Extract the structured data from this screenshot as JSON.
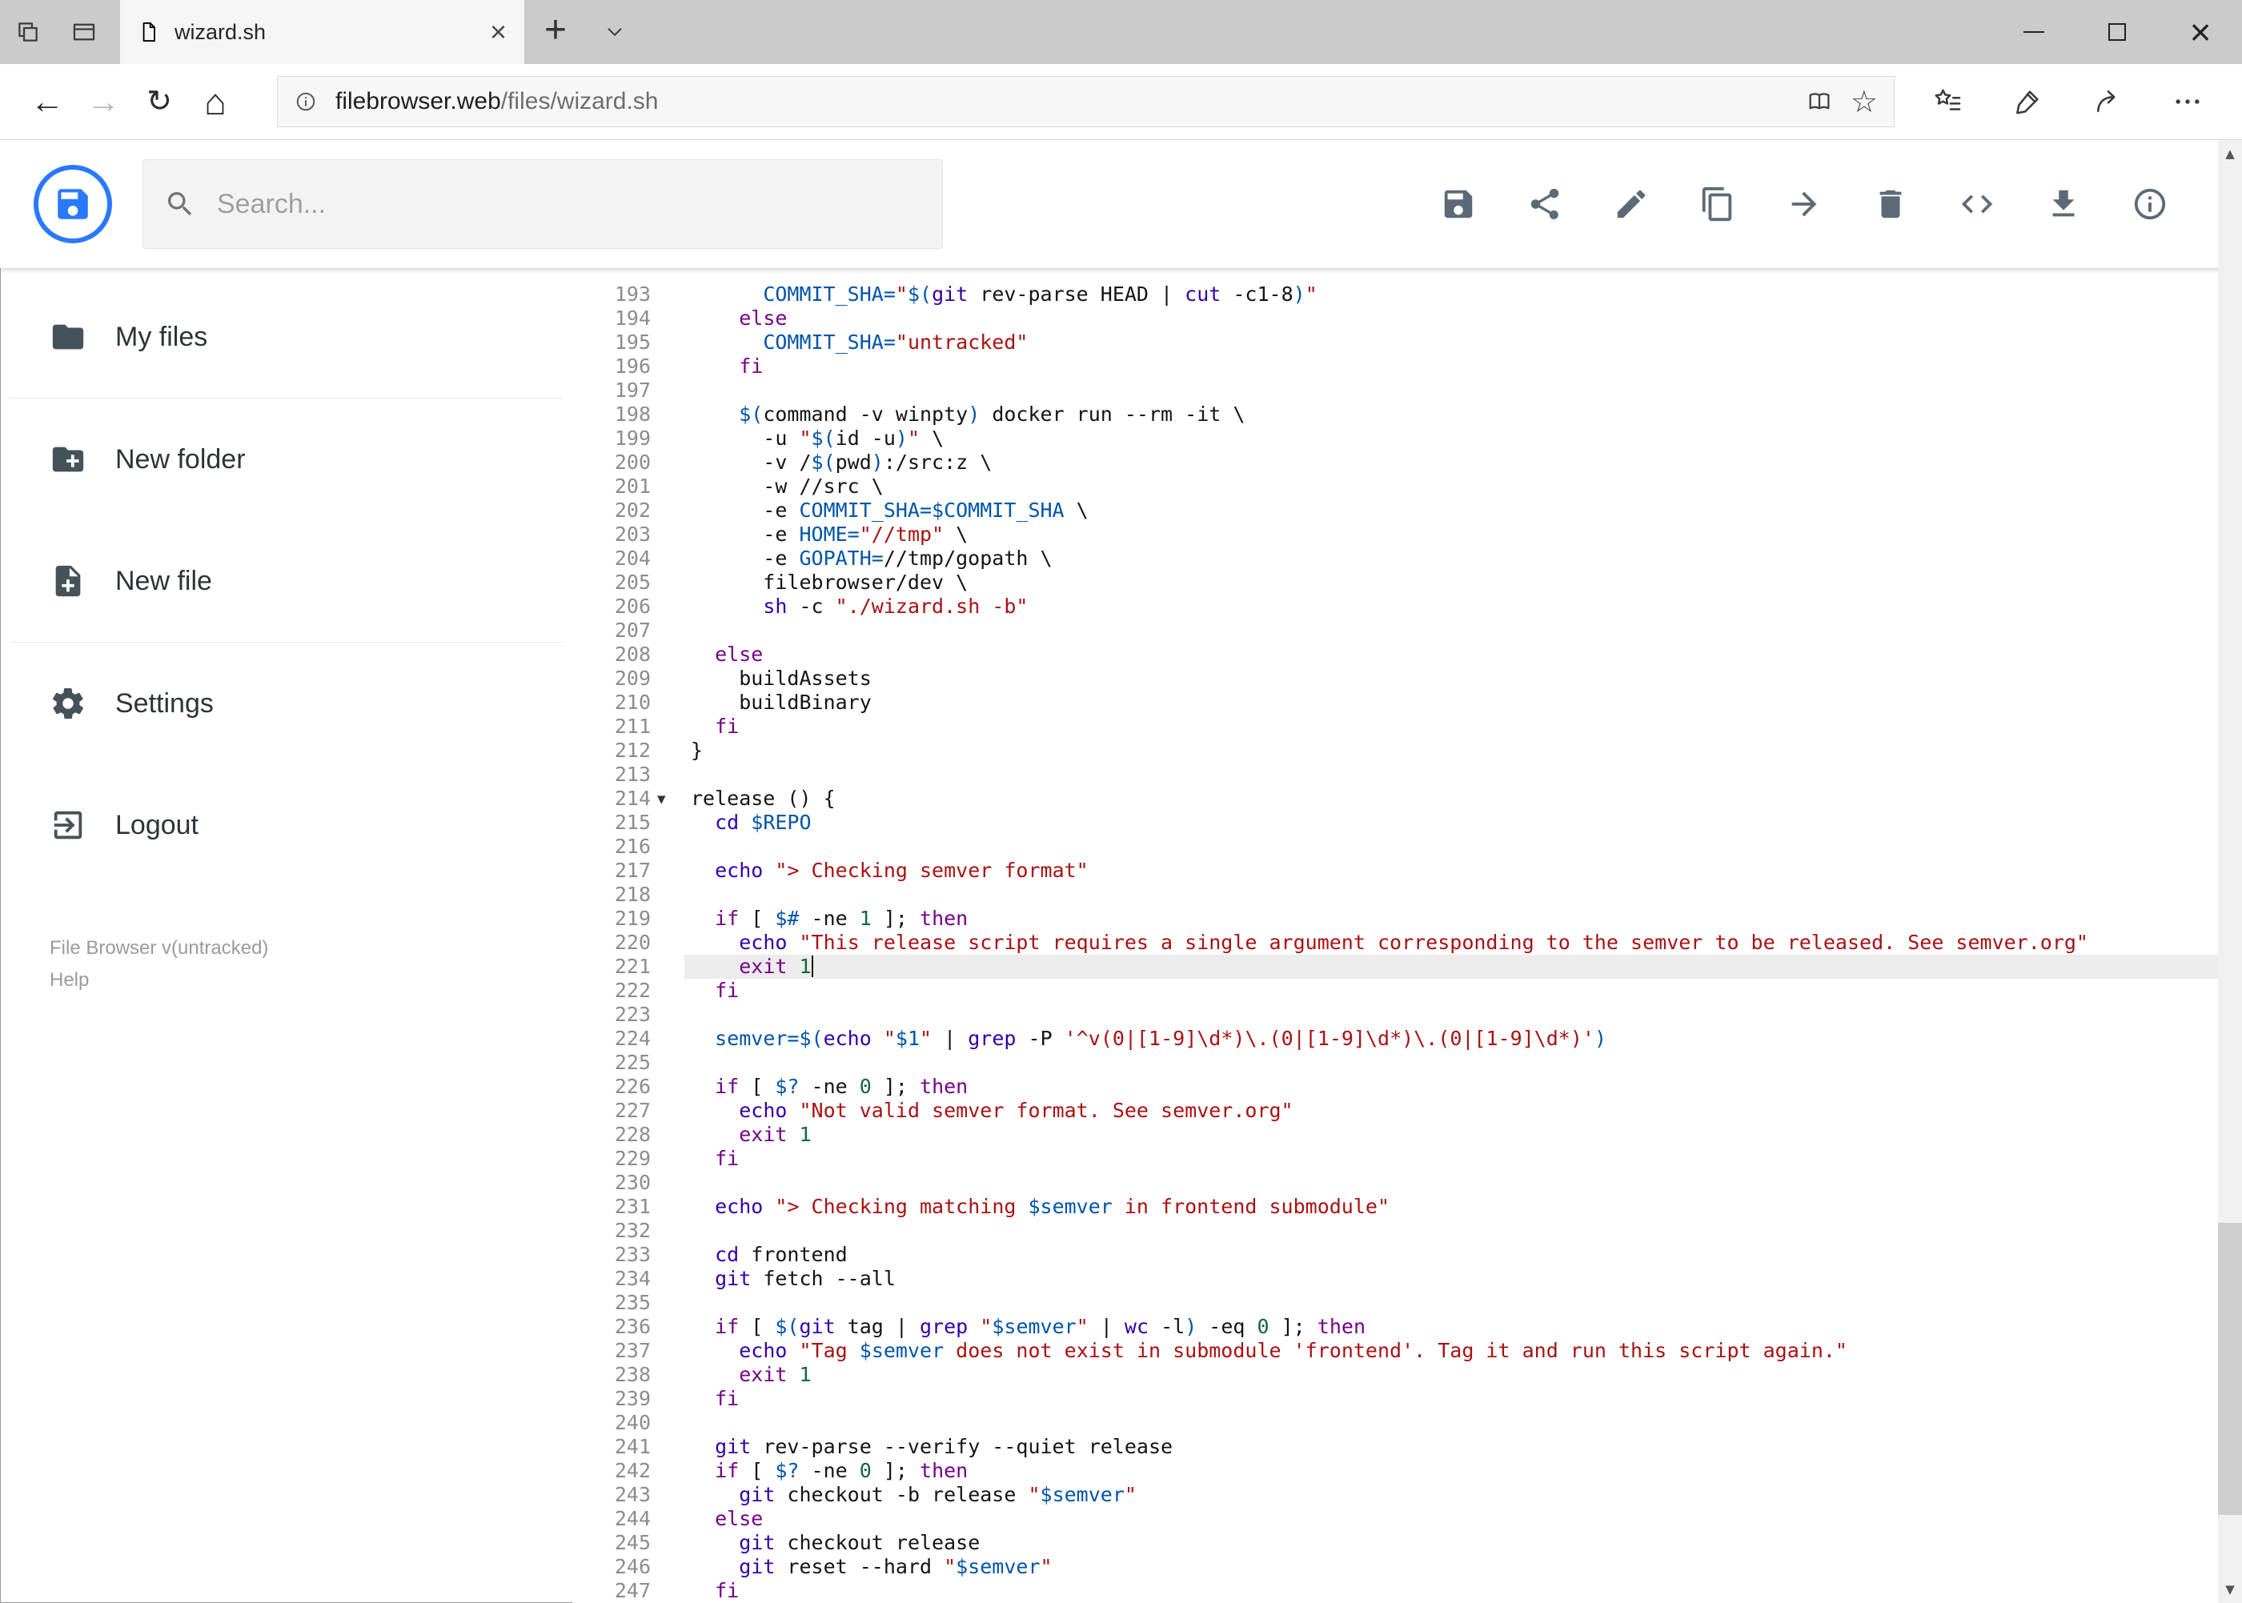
{
  "browser": {
    "tab_title": "wizard.sh",
    "address": {
      "domain": "filebrowser.web",
      "path": "/files/wizard.sh"
    }
  },
  "icons": {
    "back": "←",
    "forward": "→",
    "refresh": "↻",
    "home": "⌂",
    "favorite_star": "☆",
    "new_tab": "+",
    "tab_close": "×",
    "close": "×",
    "fold_open": "▾",
    "scroll_up": "▲",
    "scroll_down": "▼"
  },
  "header": {
    "search_placeholder": "Search..."
  },
  "sidebar": {
    "items": [
      {
        "label": "My files"
      },
      {
        "label": "New folder"
      },
      {
        "label": "New file"
      },
      {
        "label": "Settings"
      },
      {
        "label": "Logout"
      }
    ],
    "version": "File Browser v(untracked)",
    "help": "Help"
  },
  "theme": {
    "accent": "#2979ff",
    "tk-p": "#141414",
    "tk-k": "#770088",
    "tk-b": "#3300aa",
    "tk-v": "#0055aa",
    "tk-s": "#aa1111",
    "tk-n": "#116644",
    "active-line": "#ececec"
  },
  "editor": {
    "active_line": 221,
    "cursor_line": 221,
    "lines": [
      {
        "n": 193,
        "tokens": [
          [
            "p",
            "      "
          ],
          [
            "v",
            "COMMIT_SHA="
          ],
          [
            "s",
            "\""
          ],
          [
            "v",
            "$("
          ],
          [
            "b",
            "git"
          ],
          [
            "p",
            " rev-parse HEAD | "
          ],
          [
            "b",
            "cut"
          ],
          [
            "p",
            " -c1-8"
          ],
          [
            "v",
            ")"
          ],
          [
            "s",
            "\""
          ]
        ]
      },
      {
        "n": 194,
        "tokens": [
          [
            "p",
            "    "
          ],
          [
            "k",
            "else"
          ]
        ]
      },
      {
        "n": 195,
        "tokens": [
          [
            "p",
            "      "
          ],
          [
            "v",
            "COMMIT_SHA="
          ],
          [
            "s",
            "\"untracked\""
          ]
        ]
      },
      {
        "n": 196,
        "tokens": [
          [
            "p",
            "    "
          ],
          [
            "k",
            "fi"
          ]
        ]
      },
      {
        "n": 197,
        "tokens": []
      },
      {
        "n": 198,
        "tokens": [
          [
            "p",
            "    "
          ],
          [
            "v",
            "$("
          ],
          [
            "p",
            "command -v winpty"
          ],
          [
            "v",
            ")"
          ],
          [
            "p",
            " docker run --rm -it \\"
          ]
        ]
      },
      {
        "n": 199,
        "tokens": [
          [
            "p",
            "      -u "
          ],
          [
            "s",
            "\""
          ],
          [
            "v",
            "$("
          ],
          [
            "p",
            "id -u"
          ],
          [
            "v",
            ")"
          ],
          [
            "s",
            "\""
          ],
          [
            "p",
            " \\"
          ]
        ]
      },
      {
        "n": 200,
        "tokens": [
          [
            "p",
            "      -v /"
          ],
          [
            "v",
            "$("
          ],
          [
            "p",
            "pwd"
          ],
          [
            "v",
            ")"
          ],
          [
            "p",
            ":/src:z \\"
          ]
        ]
      },
      {
        "n": 201,
        "tokens": [
          [
            "p",
            "      -w //src \\"
          ]
        ]
      },
      {
        "n": 202,
        "tokens": [
          [
            "p",
            "      -e "
          ],
          [
            "v",
            "COMMIT_SHA=$COMMIT_SHA"
          ],
          [
            "p",
            " \\"
          ]
        ]
      },
      {
        "n": 203,
        "tokens": [
          [
            "p",
            "      -e "
          ],
          [
            "v",
            "HOME="
          ],
          [
            "s",
            "\"//tmp\""
          ],
          [
            "p",
            " \\"
          ]
        ]
      },
      {
        "n": 204,
        "tokens": [
          [
            "p",
            "      -e "
          ],
          [
            "v",
            "GOPATH="
          ],
          [
            "p",
            "//tmp/gopath \\"
          ]
        ]
      },
      {
        "n": 205,
        "tokens": [
          [
            "p",
            "      filebrowser/dev \\"
          ]
        ]
      },
      {
        "n": 206,
        "tokens": [
          [
            "p",
            "      "
          ],
          [
            "b",
            "sh"
          ],
          [
            "p",
            " -c "
          ],
          [
            "s",
            "\"./wizard.sh -b\""
          ]
        ]
      },
      {
        "n": 207,
        "tokens": []
      },
      {
        "n": 208,
        "tokens": [
          [
            "p",
            "  "
          ],
          [
            "k",
            "else"
          ]
        ]
      },
      {
        "n": 209,
        "tokens": [
          [
            "p",
            "    buildAssets"
          ]
        ]
      },
      {
        "n": 210,
        "tokens": [
          [
            "p",
            "    buildBinary"
          ]
        ]
      },
      {
        "n": 211,
        "tokens": [
          [
            "p",
            "  "
          ],
          [
            "k",
            "fi"
          ]
        ]
      },
      {
        "n": 212,
        "tokens": [
          [
            "p",
            "}"
          ]
        ]
      },
      {
        "n": 213,
        "tokens": []
      },
      {
        "n": 214,
        "fold": true,
        "tokens": [
          [
            "p",
            "release () {"
          ]
        ]
      },
      {
        "n": 215,
        "tokens": [
          [
            "p",
            "  "
          ],
          [
            "b",
            "cd"
          ],
          [
            "p",
            " "
          ],
          [
            "v",
            "$REPO"
          ]
        ]
      },
      {
        "n": 216,
        "tokens": []
      },
      {
        "n": 217,
        "tokens": [
          [
            "p",
            "  "
          ],
          [
            "b",
            "echo"
          ],
          [
            "p",
            " "
          ],
          [
            "s",
            "\"> Checking semver format\""
          ]
        ]
      },
      {
        "n": 218,
        "tokens": []
      },
      {
        "n": 219,
        "tokens": [
          [
            "p",
            "  "
          ],
          [
            "k",
            "if"
          ],
          [
            "p",
            " [ "
          ],
          [
            "v",
            "$#"
          ],
          [
            "p",
            " -ne "
          ],
          [
            "n",
            "1"
          ],
          [
            "p",
            " ]; "
          ],
          [
            "k",
            "then"
          ]
        ]
      },
      {
        "n": 220,
        "tokens": [
          [
            "p",
            "    "
          ],
          [
            "b",
            "echo"
          ],
          [
            "p",
            " "
          ],
          [
            "s",
            "\"This release script requires a single argument corresponding to the semver to be released. See semver.org\""
          ]
        ]
      },
      {
        "n": 221,
        "tokens": [
          [
            "p",
            "    "
          ],
          [
            "k",
            "exit"
          ],
          [
            "p",
            " "
          ],
          [
            "n",
            "1"
          ]
        ]
      },
      {
        "n": 222,
        "tokens": [
          [
            "p",
            "  "
          ],
          [
            "k",
            "fi"
          ]
        ]
      },
      {
        "n": 223,
        "tokens": []
      },
      {
        "n": 224,
        "tokens": [
          [
            "p",
            "  "
          ],
          [
            "v",
            "semver="
          ],
          [
            "v",
            "$("
          ],
          [
            "b",
            "echo"
          ],
          [
            "p",
            " "
          ],
          [
            "s",
            "\""
          ],
          [
            "v",
            "$1"
          ],
          [
            "s",
            "\""
          ],
          [
            "p",
            " | "
          ],
          [
            "b",
            "grep"
          ],
          [
            "p",
            " -P "
          ],
          [
            "s",
            "'^v(0|[1-9]\\d*)\\.(0|[1-9]\\d*)\\.(0|[1-9]\\d*)'"
          ],
          [
            "v",
            ")"
          ]
        ]
      },
      {
        "n": 225,
        "tokens": []
      },
      {
        "n": 226,
        "tokens": [
          [
            "p",
            "  "
          ],
          [
            "k",
            "if"
          ],
          [
            "p",
            " [ "
          ],
          [
            "v",
            "$?"
          ],
          [
            "p",
            " -ne "
          ],
          [
            "n",
            "0"
          ],
          [
            "p",
            " ]; "
          ],
          [
            "k",
            "then"
          ]
        ]
      },
      {
        "n": 227,
        "tokens": [
          [
            "p",
            "    "
          ],
          [
            "b",
            "echo"
          ],
          [
            "p",
            " "
          ],
          [
            "s",
            "\"Not valid semver format. See semver.org\""
          ]
        ]
      },
      {
        "n": 228,
        "tokens": [
          [
            "p",
            "    "
          ],
          [
            "k",
            "exit"
          ],
          [
            "p",
            " "
          ],
          [
            "n",
            "1"
          ]
        ]
      },
      {
        "n": 229,
        "tokens": [
          [
            "p",
            "  "
          ],
          [
            "k",
            "fi"
          ]
        ]
      },
      {
        "n": 230,
        "tokens": []
      },
      {
        "n": 231,
        "tokens": [
          [
            "p",
            "  "
          ],
          [
            "b",
            "echo"
          ],
          [
            "p",
            " "
          ],
          [
            "s",
            "\"> Checking matching "
          ],
          [
            "v",
            "$semver"
          ],
          [
            "s",
            " in frontend submodule\""
          ]
        ]
      },
      {
        "n": 232,
        "tokens": []
      },
      {
        "n": 233,
        "tokens": [
          [
            "p",
            "  "
          ],
          [
            "b",
            "cd"
          ],
          [
            "p",
            " frontend"
          ]
        ]
      },
      {
        "n": 234,
        "tokens": [
          [
            "p",
            "  "
          ],
          [
            "b",
            "git"
          ],
          [
            "p",
            " fetch --all"
          ]
        ]
      },
      {
        "n": 235,
        "tokens": []
      },
      {
        "n": 236,
        "tokens": [
          [
            "p",
            "  "
          ],
          [
            "k",
            "if"
          ],
          [
            "p",
            " [ "
          ],
          [
            "v",
            "$("
          ],
          [
            "b",
            "git"
          ],
          [
            "p",
            " tag | "
          ],
          [
            "b",
            "grep"
          ],
          [
            "p",
            " "
          ],
          [
            "s",
            "\""
          ],
          [
            "v",
            "$semver"
          ],
          [
            "s",
            "\""
          ],
          [
            "p",
            " | "
          ],
          [
            "b",
            "wc"
          ],
          [
            "p",
            " -l"
          ],
          [
            "v",
            ")"
          ],
          [
            "p",
            " -eq "
          ],
          [
            "n",
            "0"
          ],
          [
            "p",
            " ]; "
          ],
          [
            "k",
            "then"
          ]
        ]
      },
      {
        "n": 237,
        "tokens": [
          [
            "p",
            "    "
          ],
          [
            "b",
            "echo"
          ],
          [
            "p",
            " "
          ],
          [
            "s",
            "\"Tag "
          ],
          [
            "v",
            "$semver"
          ],
          [
            "s",
            " does not exist in submodule 'frontend'. Tag it and run this script again.\""
          ]
        ]
      },
      {
        "n": 238,
        "tokens": [
          [
            "p",
            "    "
          ],
          [
            "k",
            "exit"
          ],
          [
            "p",
            " "
          ],
          [
            "n",
            "1"
          ]
        ]
      },
      {
        "n": 239,
        "tokens": [
          [
            "p",
            "  "
          ],
          [
            "k",
            "fi"
          ]
        ]
      },
      {
        "n": 240,
        "tokens": []
      },
      {
        "n": 241,
        "tokens": [
          [
            "p",
            "  "
          ],
          [
            "b",
            "git"
          ],
          [
            "p",
            " rev-parse --verify --quiet release"
          ]
        ]
      },
      {
        "n": 242,
        "tokens": [
          [
            "p",
            "  "
          ],
          [
            "k",
            "if"
          ],
          [
            "p",
            " [ "
          ],
          [
            "v",
            "$?"
          ],
          [
            "p",
            " -ne "
          ],
          [
            "n",
            "0"
          ],
          [
            "p",
            " ]; "
          ],
          [
            "k",
            "then"
          ]
        ]
      },
      {
        "n": 243,
        "tokens": [
          [
            "p",
            "    "
          ],
          [
            "b",
            "git"
          ],
          [
            "p",
            " checkout -b release "
          ],
          [
            "s",
            "\""
          ],
          [
            "v",
            "$semver"
          ],
          [
            "s",
            "\""
          ]
        ]
      },
      {
        "n": 244,
        "tokens": [
          [
            "p",
            "  "
          ],
          [
            "k",
            "else"
          ]
        ]
      },
      {
        "n": 245,
        "tokens": [
          [
            "p",
            "    "
          ],
          [
            "b",
            "git"
          ],
          [
            "p",
            " checkout release"
          ]
        ]
      },
      {
        "n": 246,
        "tokens": [
          [
            "p",
            "    "
          ],
          [
            "b",
            "git"
          ],
          [
            "p",
            " reset --hard "
          ],
          [
            "s",
            "\""
          ],
          [
            "v",
            "$semver"
          ],
          [
            "s",
            "\""
          ]
        ]
      },
      {
        "n": 247,
        "tokens": [
          [
            "p",
            "  "
          ],
          [
            "k",
            "fi"
          ]
        ]
      }
    ]
  }
}
